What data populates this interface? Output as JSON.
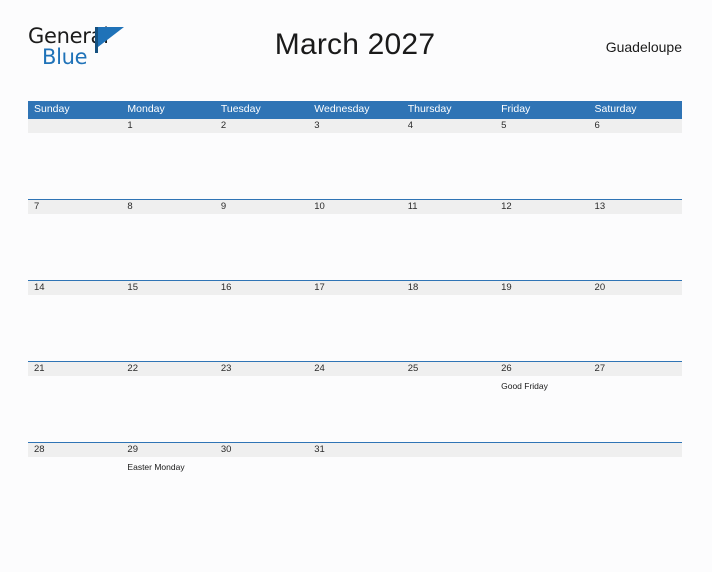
{
  "brand": {
    "name_top": "General",
    "name_bottom": "Blue",
    "color_blue": "#1f72b8",
    "color_dark": "#1b1b1b"
  },
  "header": {
    "title": "March 2027",
    "locale": "Guadeloupe"
  },
  "colors": {
    "header_blue": "#2f74b5",
    "strip_gray": "#efefef",
    "page_background": "#fcfcfd",
    "text": "#222222"
  },
  "calendar": {
    "month": "March",
    "year": "2027",
    "weekday_headers": [
      "Sunday",
      "Monday",
      "Tuesday",
      "Wednesday",
      "Thursday",
      "Friday",
      "Saturday"
    ],
    "weeks": [
      [
        {
          "date": "",
          "event": ""
        },
        {
          "date": "1",
          "event": ""
        },
        {
          "date": "2",
          "event": ""
        },
        {
          "date": "3",
          "event": ""
        },
        {
          "date": "4",
          "event": ""
        },
        {
          "date": "5",
          "event": ""
        },
        {
          "date": "6",
          "event": ""
        }
      ],
      [
        {
          "date": "7",
          "event": ""
        },
        {
          "date": "8",
          "event": ""
        },
        {
          "date": "9",
          "event": ""
        },
        {
          "date": "10",
          "event": ""
        },
        {
          "date": "11",
          "event": ""
        },
        {
          "date": "12",
          "event": ""
        },
        {
          "date": "13",
          "event": ""
        }
      ],
      [
        {
          "date": "14",
          "event": ""
        },
        {
          "date": "15",
          "event": ""
        },
        {
          "date": "16",
          "event": ""
        },
        {
          "date": "17",
          "event": ""
        },
        {
          "date": "18",
          "event": ""
        },
        {
          "date": "19",
          "event": ""
        },
        {
          "date": "20",
          "event": ""
        }
      ],
      [
        {
          "date": "21",
          "event": ""
        },
        {
          "date": "22",
          "event": ""
        },
        {
          "date": "23",
          "event": ""
        },
        {
          "date": "24",
          "event": ""
        },
        {
          "date": "25",
          "event": ""
        },
        {
          "date": "26",
          "event": "Good Friday"
        },
        {
          "date": "27",
          "event": ""
        }
      ],
      [
        {
          "date": "28",
          "event": ""
        },
        {
          "date": "29",
          "event": "Easter Monday"
        },
        {
          "date": "30",
          "event": ""
        },
        {
          "date": "31",
          "event": ""
        },
        {
          "date": "",
          "event": ""
        },
        {
          "date": "",
          "event": ""
        },
        {
          "date": "",
          "event": ""
        }
      ]
    ]
  }
}
